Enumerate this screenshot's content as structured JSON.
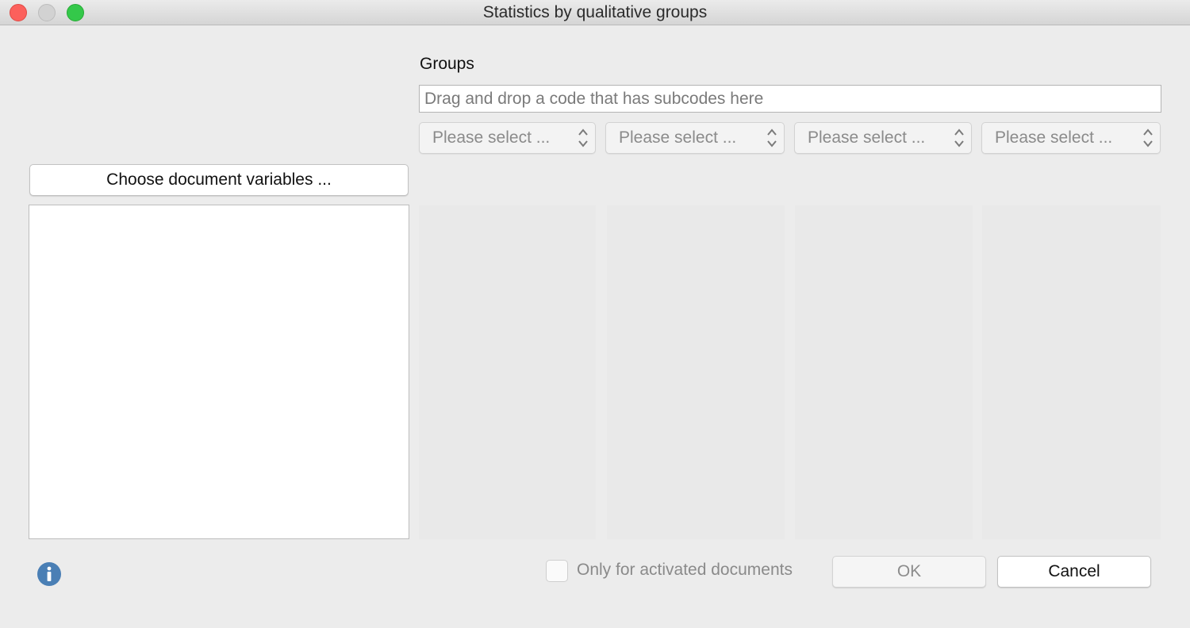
{
  "window": {
    "title": "Statistics by qualitative groups"
  },
  "groups": {
    "label": "Groups",
    "drop_placeholder": "Drag and drop a code that has subcodes here",
    "selects": [
      {
        "value": "Please select ..."
      },
      {
        "value": "Please select ..."
      },
      {
        "value": "Please select ..."
      },
      {
        "value": "Please select ..."
      }
    ]
  },
  "variables": {
    "choose_button_label": "Choose document variables ..."
  },
  "footer": {
    "checkbox_label": "Only for activated documents",
    "checkbox_checked": false,
    "ok_label": "OK",
    "cancel_label": "Cancel"
  },
  "icons": {
    "info": "info-icon",
    "select_arrows": "chevron-up-down-icon"
  },
  "colors": {
    "close": "#fc605c",
    "minimize": "#d2d2d2",
    "zoom": "#34c84a",
    "info": "#4a7fb5"
  }
}
